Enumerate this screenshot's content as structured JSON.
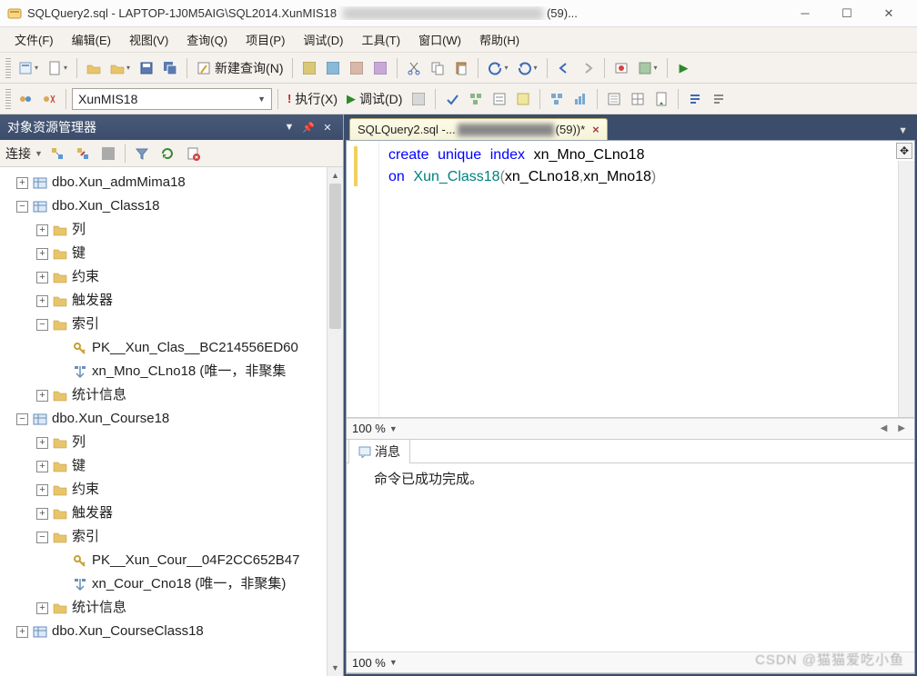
{
  "window": {
    "title": "SQLQuery2.sql - LAPTOP-1J0M5AIG\\SQL2014.XunMIS18",
    "title_suffix": "(59)..."
  },
  "menu": {
    "file": "文件(F)",
    "edit": "编辑(E)",
    "view": "视图(V)",
    "query": "查询(Q)",
    "project": "项目(P)",
    "debug": "调试(D)",
    "tools": "工具(T)",
    "window": "窗口(W)",
    "help": "帮助(H)"
  },
  "toolbar": {
    "new_query": "新建查询(N)",
    "database": "XunMIS18",
    "execute": "执行(X)",
    "debug": "调试(D)"
  },
  "sidebar": {
    "title": "对象资源管理器",
    "connect": "连接",
    "tree": [
      {
        "depth": 0,
        "exp": "+",
        "icon": "table",
        "label": "dbo.Xun_admMima18"
      },
      {
        "depth": 0,
        "exp": "-",
        "icon": "table",
        "label": "dbo.Xun_Class18"
      },
      {
        "depth": 1,
        "exp": "+",
        "icon": "folder",
        "label": "列"
      },
      {
        "depth": 1,
        "exp": "+",
        "icon": "folder",
        "label": "键"
      },
      {
        "depth": 1,
        "exp": "+",
        "icon": "folder",
        "label": "约束"
      },
      {
        "depth": 1,
        "exp": "+",
        "icon": "folder",
        "label": "触发器"
      },
      {
        "depth": 1,
        "exp": "-",
        "icon": "folder",
        "label": "索引"
      },
      {
        "depth": 2,
        "exp": "",
        "icon": "key",
        "label": "PK__Xun_Clas__BC214556ED60"
      },
      {
        "depth": 2,
        "exp": "",
        "icon": "index",
        "label": "xn_Mno_CLno18 (唯一，非聚集"
      },
      {
        "depth": 1,
        "exp": "+",
        "icon": "folder",
        "label": "统计信息"
      },
      {
        "depth": 0,
        "exp": "-",
        "icon": "table",
        "label": "dbo.Xun_Course18"
      },
      {
        "depth": 1,
        "exp": "+",
        "icon": "folder",
        "label": "列"
      },
      {
        "depth": 1,
        "exp": "+",
        "icon": "folder",
        "label": "键"
      },
      {
        "depth": 1,
        "exp": "+",
        "icon": "folder",
        "label": "约束"
      },
      {
        "depth": 1,
        "exp": "+",
        "icon": "folder",
        "label": "触发器"
      },
      {
        "depth": 1,
        "exp": "-",
        "icon": "folder",
        "label": "索引"
      },
      {
        "depth": 2,
        "exp": "",
        "icon": "key",
        "label": "PK__Xun_Cour__04F2CC652B47"
      },
      {
        "depth": 2,
        "exp": "",
        "icon": "index",
        "label": "xn_Cour_Cno18 (唯一，非聚集)"
      },
      {
        "depth": 1,
        "exp": "+",
        "icon": "folder",
        "label": "统计信息"
      },
      {
        "depth": 0,
        "exp": "+",
        "icon": "table",
        "label": "dbo.Xun_CourseClass18"
      }
    ]
  },
  "tab": {
    "prefix": "SQLQuery2.sql -...",
    "suffix": " (59))*"
  },
  "code": {
    "line1_kw1": "create",
    "line1_kw2": "unique",
    "line1_kw3": "index",
    "line1_name": "xn_Mno_CLno18",
    "line2_kw": "on",
    "line2_table": "Xun_Class18",
    "line2_col1": "xn_CLno18",
    "line2_col2": "xn_Mno18"
  },
  "zoom": {
    "value": "100 %"
  },
  "messages": {
    "tab": "消息",
    "body": "命令已成功完成。"
  },
  "watermark": "CSDN @猫猫爱吃小鱼"
}
